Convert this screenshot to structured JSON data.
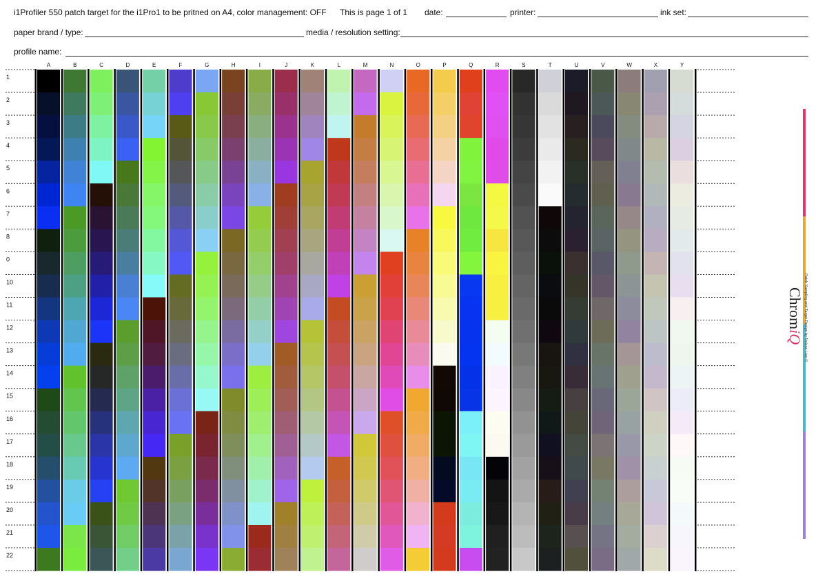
{
  "header": {
    "title": "i1Profiler 550 patch target for the i1Pro1 to be pritned on A4, color management: OFF",
    "page": "This is page 1 of 1",
    "date_label": "date:",
    "printer_label": "printer:",
    "inkset_label": "ink set:",
    "paper_label": "paper brand / type:",
    "media_label": "media / resolution setting:",
    "profile_label": "profile name:"
  },
  "brand": {
    "credit": "Patch Sampling and Target Design by Nelson Liao ©",
    "logo_main": "Chrom",
    "logo_accent": "iQ",
    "accent_color": "#d8396a"
  },
  "side_strip_colors": [
    "#d8396a",
    "#e5a63a",
    "#4bb6c7",
    "#9b7fd6"
  ],
  "columns": [
    "A",
    "B",
    "C",
    "D",
    "E",
    "F",
    "G",
    "H",
    "I",
    "J",
    "K",
    "L",
    "M",
    "N",
    "O",
    "P",
    "Q",
    "R",
    "S",
    "T",
    "U",
    "V",
    "W",
    "X",
    "Y"
  ],
  "rows": [
    "1",
    "2",
    "3",
    "4",
    "5",
    "6",
    "7",
    "8",
    "0",
    "10",
    "11",
    "12",
    "13",
    "14",
    "15",
    "16",
    "17",
    "18",
    "19",
    "20",
    "21",
    "22"
  ],
  "patches": [
    [
      "#000000",
      "#061029",
      "#061040",
      "#041858",
      "#0624a0",
      "#0026d3",
      "#0a2ef2",
      "#10200e",
      "#18282c",
      "#182c50",
      "#143680",
      "#0e38b4",
      "#063cd8",
      "#0540ee",
      "#1f4a18",
      "#234c32",
      "#234e48",
      "#244e6c",
      "#2450a0",
      "#2454cc",
      "#1f56ea",
      "#3d7a1f"
    ],
    [
      "#3e7833",
      "#3f7a5e",
      "#3d7c86",
      "#3e80b0",
      "#3f82d6",
      "#3e84f2",
      "#4c9a26",
      "#4c9c3e",
      "#4e9e62",
      "#4ea084",
      "#4ea6b2",
      "#50a8d2",
      "#50acee",
      "#62c22e",
      "#62c64e",
      "#64c66c",
      "#68c88e",
      "#68cab2",
      "#6acce6",
      "#68ccf4",
      "#7ae64a",
      "#7aec40"
    ],
    [
      "#7ef05e",
      "#7ef078",
      "#7ef2a0",
      "#7ef4c4",
      "#80f8f4",
      "#241006",
      "#2a1232",
      "#281650",
      "#261c78",
      "#2020a8",
      "#1c28d6",
      "#1c34f8",
      "#2a2a10",
      "#262828",
      "#252a50",
      "#26327c",
      "#2a36a8",
      "#2634d0",
      "#2640f4",
      "#3a5218",
      "#3a5436",
      "#3a5656"
    ],
    [
      "#3a5478",
      "#3a56a0",
      "#3a58c8",
      "#3a60f4",
      "#48781c",
      "#4a7838",
      "#4a7a58",
      "#4a7c78",
      "#4a7ea0",
      "#4a80d4",
      "#4a86f4",
      "#5c9e2e",
      "#5e9e46",
      "#5ea26a",
      "#5ea486",
      "#5ea6b0",
      "#5ea8d0",
      "#5eaaf2",
      "#70c832",
      "#70ca46",
      "#72cc66",
      "#72ce88"
    ],
    [
      "#74d0a6",
      "#76d2d4",
      "#76d4f8",
      "#82f432",
      "#84f448",
      "#84f668",
      "#84f87a",
      "#84f8a0",
      "#86f8c4",
      "#86faf8",
      "#4c1408",
      "#4e1626",
      "#501c40",
      "#4c1c6c",
      "#4a20a4",
      "#4826d2",
      "#4628f4",
      "#523810",
      "#523428",
      "#4e3452",
      "#4c367a",
      "#4c3aa4"
    ],
    [
      "#4e3ccc",
      "#4e40f0",
      "#585a16",
      "#545438",
      "#545658",
      "#545a7c",
      "#5458a6",
      "#5458d6",
      "#5258f4",
      "#646c24",
      "#686a3c",
      "#6a6a5e",
      "#6a6c80",
      "#6a6ea8",
      "#6a70d6",
      "#6a72f4",
      "#7aa02a",
      "#7aa042",
      "#7aa060",
      "#7aa282",
      "#7aa2a8",
      "#7aa6d2"
    ],
    [
      "#7aa6f4",
      "#88c834",
      "#88c84a",
      "#88ca68",
      "#88ca88",
      "#8acca8",
      "#8acecc",
      "#8ad0f4",
      "#94f23c",
      "#96f252",
      "#94f46e",
      "#96f48c",
      "#96f6aa",
      "#96f6cc",
      "#98f8f4",
      "#7a2418",
      "#7a2430",
      "#7a2a4a",
      "#7a2c6c",
      "#7a2e9c",
      "#7a32cc",
      "#7a36f4"
    ],
    [
      "#7a4420",
      "#7a4038",
      "#7a4050",
      "#7a406e",
      "#7a4294",
      "#7a44bc",
      "#7a46e4",
      "#7a6824",
      "#7a6840",
      "#7a6a5a",
      "#7a6a7c",
      "#7a6ca0",
      "#7a6ec8",
      "#7a70ec",
      "#808c2c",
      "#808c42",
      "#808e5c",
      "#808e7c",
      "#8090a0",
      "#8090c8",
      "#8092ea",
      "#8aac32"
    ],
    [
      "#8aac48",
      "#8aac62",
      "#8aae80",
      "#8aaea0",
      "#8ab0c4",
      "#8ab0e8",
      "#94cc3a",
      "#94cc50",
      "#94ce6a",
      "#94cc88",
      "#94cea8",
      "#94d0c8",
      "#94d0ec",
      "#9eee40",
      "#9eee58",
      "#a0ee70",
      "#a0f08e",
      "#a0f0ac",
      "#a0f2cc",
      "#a0f4f0",
      "#9c2a1c",
      "#9a2c34"
    ],
    [
      "#9a2e4c",
      "#9a306a",
      "#9a328e",
      "#9a34b4",
      "#9a36e0",
      "#a03c20",
      "#a03e38",
      "#a04050",
      "#a0406a",
      "#a0428e",
      "#a044b4",
      "#a046e0",
      "#a05c24",
      "#a05c3c",
      "#a05e56",
      "#a05e74",
      "#a06096",
      "#a062bc",
      "#a064e8",
      "#a08028",
      "#a08040",
      "#a0825a"
    ],
    [
      "#a08278",
      "#a0849a",
      "#a084be",
      "#a086e6",
      "#a8a430",
      "#a8a446",
      "#a8a660",
      "#a8a67e",
      "#a8a8a0",
      "#a8a8c4",
      "#a8aaea",
      "#b4c436",
      "#b4c44c",
      "#b4c666",
      "#b4c684",
      "#b4c8a6",
      "#b4c8c8",
      "#b4caee",
      "#bef03c",
      "#bef058",
      "#c0f070",
      "#c0f290"
    ],
    [
      "#c0f2b0",
      "#c0f4d0",
      "#c0f4f0",
      "#c0381c",
      "#c0383a",
      "#c03a54",
      "#c03c72",
      "#c03e94",
      "#c040b8",
      "#c042e4",
      "#c44c22",
      "#c44e3a",
      "#c45052",
      "#c4506c",
      "#c45290",
      "#c454b6",
      "#c456e4",
      "#c46028",
      "#c4603e",
      "#c4625a",
      "#c46478",
      "#c4669c"
    ],
    [
      "#c468c2",
      "#c46aec",
      "#c47c2c",
      "#c47e44",
      "#c47e5e",
      "#c48080",
      "#c482a0",
      "#c484c4",
      "#c484ee",
      "#caa034",
      "#caa24a",
      "#caa264",
      "#caa480",
      "#caa6a2",
      "#caa6c4",
      "#caa8ee",
      "#d0c838",
      "#d0c850",
      "#d0ca6a",
      "#d0ca88",
      "#d0ccaa",
      "#d0cccc"
    ],
    [
      "#d0d0f4",
      "#d8f440",
      "#d8f45a",
      "#d8f474",
      "#d8f692",
      "#d8f6ae",
      "#d8f8cc",
      "#d8f8f0",
      "#e04020",
      "#e04038",
      "#e04252",
      "#e04472",
      "#e04694",
      "#e04ab8",
      "#e04ce6",
      "#e05028",
      "#e0503e",
      "#e05258",
      "#e05474",
      "#e05696",
      "#e058bc",
      "#e05ce6"
    ],
    [
      "#e86824",
      "#e8683a",
      "#e86a54",
      "#e86c72",
      "#e86e94",
      "#e870b8",
      "#e872ea",
      "#e88228",
      "#e88440",
      "#e8865a",
      "#e88878",
      "#e88a98",
      "#e88cbc",
      "#e88eea",
      "#f0a830",
      "#f0aa48",
      "#f0ac64",
      "#f0ae82",
      "#f0b0a4",
      "#f0b2cc",
      "#f0b4f4",
      "#f4cc36"
    ],
    [
      "#f4cc4c",
      "#f4ce66",
      "#f4d084",
      "#f4d2a4",
      "#f4d4c4",
      "#f4d6f0",
      "#f8f840",
      "#f8f85c",
      "#f8fa78",
      "#f8fa94",
      "#f8fab0",
      "#f8facc",
      "#fafaf0",
      "#120804",
      "#100804",
      "#0c1404",
      "#0c1406",
      "#040a20",
      "#040a28",
      "#d43a1c",
      "#d43a24",
      "#d43a1e"
    ],
    [
      "#e0401c",
      "#e04234",
      "#e0442c",
      "#80f43c",
      "#80f440",
      "#7ce640",
      "#6ee83e",
      "#70ec40",
      "#82f63c",
      "#0838f0",
      "#0634f0",
      "#0634ee",
      "#0434f0",
      "#0432e8",
      "#0634e6",
      "#7cf0f8",
      "#7ef6f4",
      "#78e6f4",
      "#78ecf2",
      "#7cecde",
      "#7ef4de",
      "#c84cf0"
    ],
    [
      "#e04cf0",
      "#e050f4",
      "#e050f0",
      "#e04ae8",
      "#e04ce8",
      "#f4f840",
      "#f4f848",
      "#f8e640",
      "#f8f440",
      "#f8f040",
      "#f8f040",
      "#f4fef0",
      "#f2fcfe",
      "#faf2fe",
      "#fcf4fe",
      "#fcfcf0",
      "#fcfaf0",
      "#040408",
      "#141414",
      "#181818",
      "#202020",
      "#222222"
    ],
    [
      "#282828",
      "#323232",
      "#363636",
      "#3c3c3c",
      "#444444",
      "#4a4a4a",
      "#525252",
      "#585858",
      "#5e5e5e",
      "#646464",
      "#6a6a6a",
      "#707070",
      "#787878",
      "#808080",
      "#888888",
      "#929292",
      "#9a9a9a",
      "#a2a2a2",
      "#aaaaaa",
      "#b4b4b4",
      "#bcbcbc",
      "#c8c8c8"
    ],
    [
      "#d0d0d8",
      "#dadada",
      "#e2e2e2",
      "#eaeaea",
      "#f2f2f2",
      "#fafafa",
      "#100808",
      "#0c0c0c",
      "#0a100a",
      "#0a0c10",
      "#0a0a0a",
      "#100810",
      "#181410",
      "#181810",
      "#141c14",
      "#101818",
      "#101020",
      "#181018",
      "#281c18",
      "#202014",
      "#1c241c",
      "#1c2020"
    ],
    [
      "#1c1c28",
      "#201820",
      "#282020",
      "#2a2a20",
      "#283028",
      "#242c30",
      "#242430",
      "#2a2030",
      "#3a3030",
      "#343428",
      "#343c34",
      "#303a3c",
      "#303040",
      "#382c38",
      "#484040",
      "#444438",
      "#444a44",
      "#404a4c",
      "#404050",
      "#483c48",
      "#585050",
      "#50503c"
    ],
    [
      "#4a5848",
      "#4c5858",
      "#4a4a5c",
      "#584c5c",
      "#646058",
      "#606050",
      "#5a665c",
      "#5a6464",
      "#585868",
      "#645868",
      "#706868",
      "#6c6c58",
      "#687468",
      "#687474",
      "#686878",
      "#706478",
      "#7c7474",
      "#787864",
      "#748274",
      "#748080",
      "#747484",
      "#7a6c84"
    ],
    [
      "#8c7c7c",
      "#888872",
      "#848c80",
      "#80888a",
      "#808090",
      "#887890",
      "#968888",
      "#949480",
      "#909a8c",
      "#8c9494",
      "#8c8c9c",
      "#9284a0",
      "#a49696",
      "#a0a08e",
      "#9ca698",
      "#98a2a2",
      "#9898a8",
      "#a090a8",
      "#ac9e9c",
      "#a8a898",
      "#a4aca0",
      "#a0a8a8"
    ],
    [
      "#a0a0b0",
      "#aaa0b0",
      "#b8aaaa",
      "#b8b8a4",
      "#b4bcb0",
      "#b0b8b8",
      "#b0b0c0",
      "#b8acc0",
      "#c4b4b4",
      "#c4c4b0",
      "#c0c8bc",
      "#bcc4c4",
      "#bcbccc",
      "#c4b8cc",
      "#d0c4c4",
      "#d0d0c0",
      "#ccd4c8",
      "#c8d0d0",
      "#c8c8d8",
      "#d0c4d8",
      "#dcd0d0",
      "#dcdcc8"
    ],
    [
      "#d6dcd2",
      "#d4dcdc",
      "#d4d4e2",
      "#dccfe2",
      "#eadede",
      "#ecece0",
      "#e6ece4",
      "#e2eaea",
      "#e2e2ee",
      "#e8def0",
      "#f8f0f0",
      "#f0f8f0",
      "#eef6ee",
      "#ecf4f4",
      "#ececf8",
      "#f4eaf8",
      "#fef8f8",
      "#f6fcf4",
      "#f8fdf8",
      "#f4fafc",
      "#f6f6fc",
      "#faf4fc"
    ]
  ]
}
